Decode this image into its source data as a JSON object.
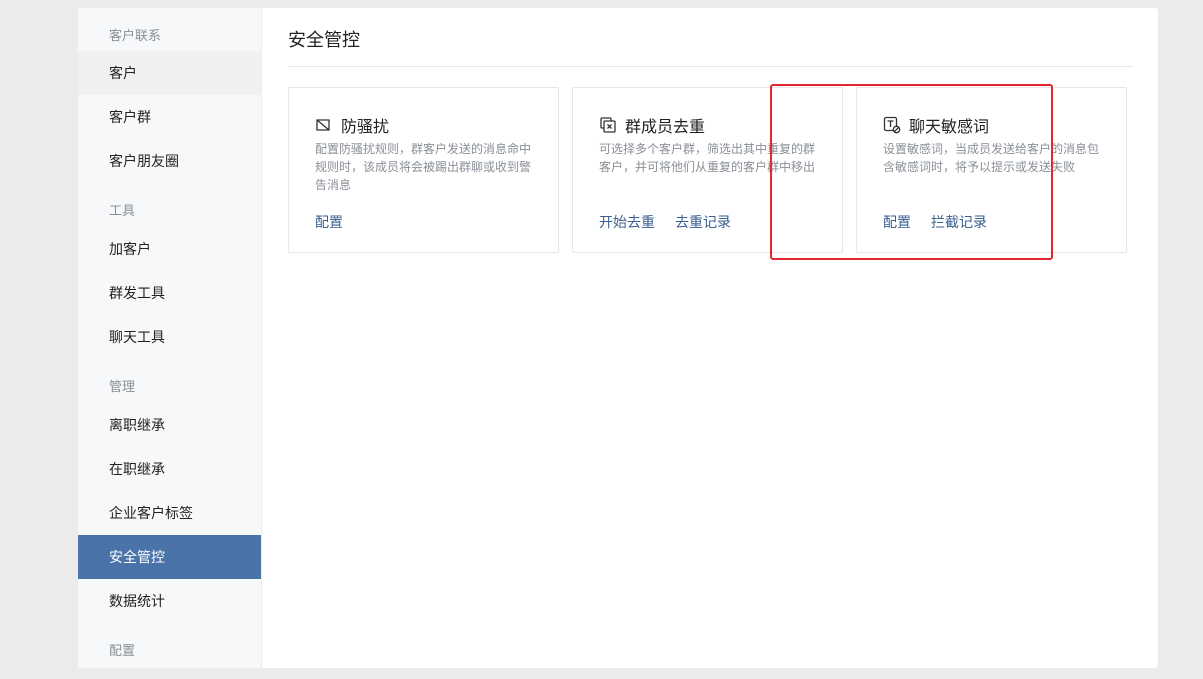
{
  "sidebar": {
    "sections": [
      {
        "label": "客户联系",
        "items": [
          {
            "label": "客户",
            "state": "hover"
          },
          {
            "label": "客户群"
          },
          {
            "label": "客户朋友圈"
          }
        ]
      },
      {
        "label": "工具",
        "items": [
          {
            "label": "加客户"
          },
          {
            "label": "群发工具"
          },
          {
            "label": "聊天工具"
          }
        ]
      },
      {
        "label": "管理",
        "items": [
          {
            "label": "离职继承"
          },
          {
            "label": "在职继承"
          },
          {
            "label": "企业客户标签"
          },
          {
            "label": "安全管控",
            "state": "active"
          },
          {
            "label": "数据统计"
          }
        ]
      },
      {
        "label": "配置",
        "items": []
      }
    ]
  },
  "main": {
    "title": "安全管控",
    "cards": [
      {
        "icon": "shield-off-icon",
        "title": "防骚扰",
        "desc": "配置防骚扰规则，群客户发送的消息命中规则时，该成员将会被踢出群聊或收到警告消息",
        "actions": [
          "配置"
        ]
      },
      {
        "icon": "dedupe-icon",
        "title": "群成员去重",
        "desc": "可选择多个客户群，筛选出其中重复的群客户，并可将他们从重复的客户群中移出",
        "actions": [
          "开始去重",
          "去重记录"
        ]
      },
      {
        "icon": "sensitive-word-icon",
        "title": "聊天敏感词",
        "desc": "设置敏感词，当成员发送给客户的消息包含敏感词时，将予以提示或发送失败",
        "actions": [
          "配置",
          "拦截记录"
        ]
      }
    ]
  },
  "colors": {
    "active_bg": "#4a74a9",
    "link": "#3a5f90",
    "highlight": "#e5262b"
  }
}
